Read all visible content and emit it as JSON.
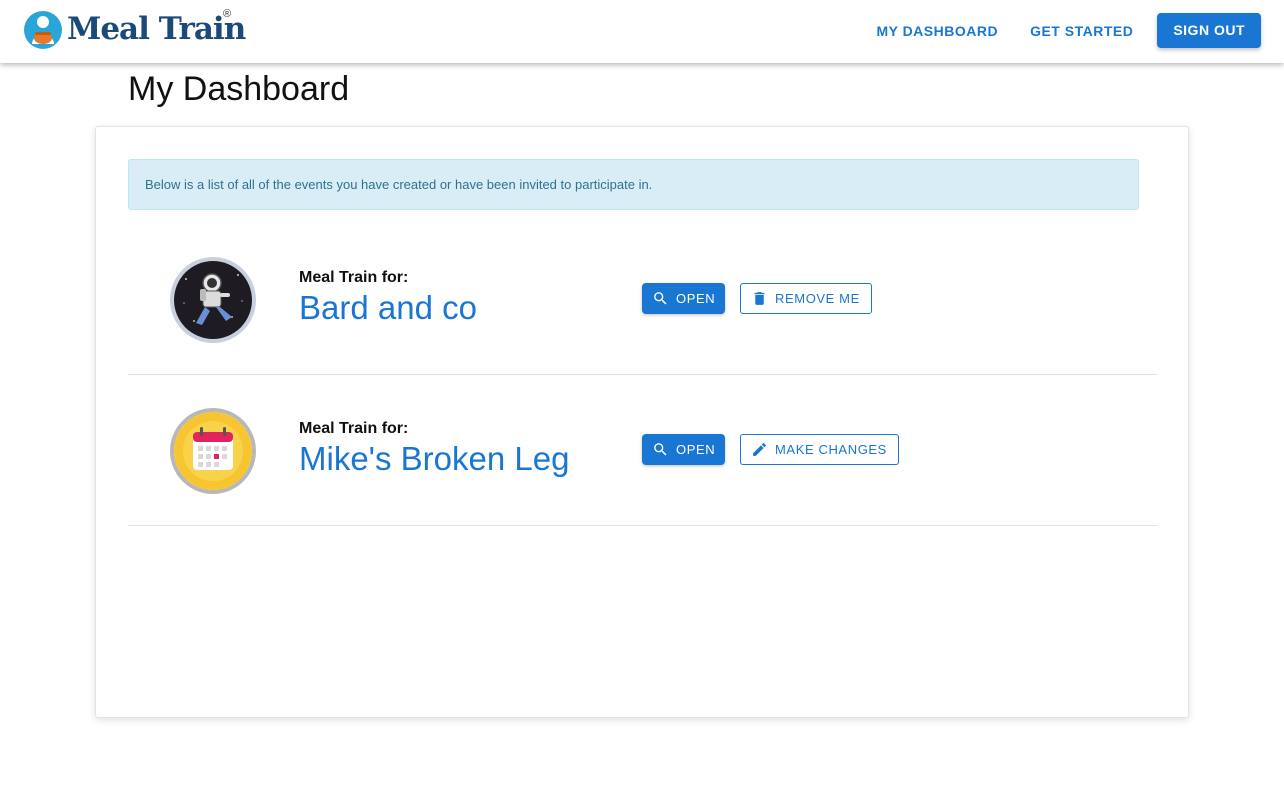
{
  "header": {
    "logo_text": "Meal Train",
    "logo_reg": "®",
    "nav": {
      "dashboard": "MY DASHBOARD",
      "get_started": "GET STARTED",
      "sign_out": "SIGN OUT"
    }
  },
  "page": {
    "title": "My Dashboard",
    "info_text": "Below is a list of all of the events you have created or have been invited to participate in."
  },
  "events": [
    {
      "label": "Meal Train for:",
      "name": "Bard and co",
      "avatar_icon": "astronaut-icon",
      "open_label": "OPEN",
      "secondary_label": "REMOVE ME",
      "secondary_icon": "trash-icon"
    },
    {
      "label": "Meal Train for:",
      "name": "Mike's Broken Leg",
      "avatar_icon": "calendar-icon",
      "open_label": "OPEN",
      "secondary_label": "MAKE CHANGES",
      "secondary_icon": "pencil-icon"
    }
  ],
  "colors": {
    "primary": "#1976d2",
    "logo": "#1b4a7a",
    "info_bg": "#d9edf7",
    "info_text": "#31708f"
  }
}
